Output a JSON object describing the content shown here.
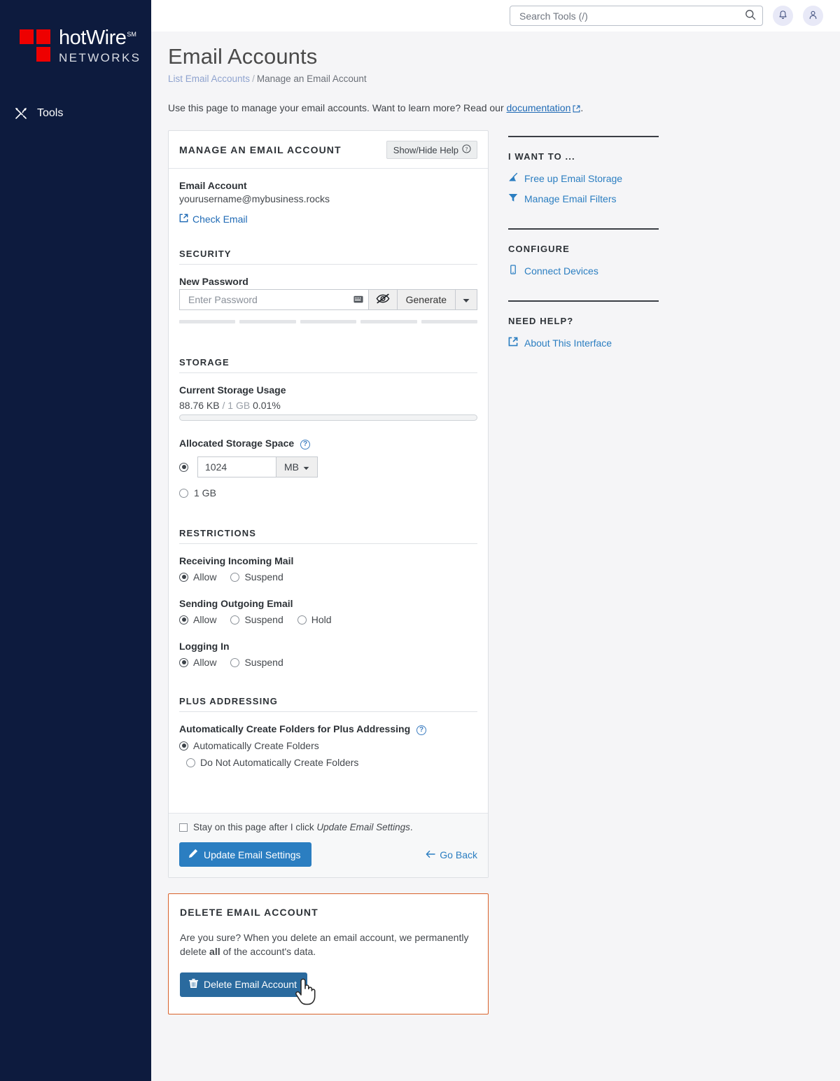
{
  "brand": {
    "name": "hotWire",
    "sm": "SM",
    "sub": "NETWORKS",
    "square_color": "#ee0000",
    "sidebar_bg": "#0d1b3e"
  },
  "sidebar": {
    "items": [
      {
        "label": "Tools",
        "icon": "tools-icon"
      }
    ]
  },
  "topbar": {
    "search": {
      "placeholder": "Search Tools (/)",
      "value": ""
    },
    "search_icon": "search-icon",
    "notifications_icon": "bell-icon",
    "account_icon": "user-icon"
  },
  "page": {
    "title": "Email Accounts",
    "breadcrumb": {
      "link": "List Email Accounts",
      "separator": "/",
      "current": "Manage an Email Account"
    },
    "intro_before": "Use this page to manage your email accounts. Want to learn more? Read our ",
    "intro_link": "documentation",
    "intro_after": "."
  },
  "card": {
    "title": "MANAGE AN EMAIL ACCOUNT",
    "help_button": "Show/Hide Help",
    "help_icon": "question-circle-icon",
    "account": {
      "label": "Email Account",
      "value": "yourusername@mybusiness.rocks",
      "check_email_link": "Check Email",
      "check_email_icon": "external-link-icon"
    },
    "security": {
      "heading": "SECURITY",
      "password_label": "New Password",
      "password_placeholder": "Enter Password",
      "password_value": "",
      "keyboard_icon": "keyboard-icon",
      "toggle_visibility_icon": "eye-slash-icon",
      "generate_label": "Generate",
      "caret_icon": "caret-down-icon",
      "strength_segments": 5
    },
    "storage": {
      "heading": "STORAGE",
      "usage_label": "Current Storage Usage",
      "usage_used": "88.76 KB",
      "usage_divider": "/",
      "usage_total": "1 GB",
      "usage_percent": "0.01%",
      "progress_value": 0.01,
      "allocated_label": "Allocated Storage Space",
      "allocated_help_icon": "question-circle-icon",
      "allocated_value": "1024",
      "allocated_unit": "MB",
      "allocated_unit_caret": "caret-down-icon",
      "allocated_selected": "custom",
      "unlimited_label": "1 GB"
    },
    "restrictions": {
      "heading": "RESTRICTIONS",
      "groups": [
        {
          "label": "Receiving Incoming Mail",
          "options": [
            "Allow",
            "Suspend"
          ],
          "selected": 0
        },
        {
          "label": "Sending Outgoing Email",
          "options": [
            "Allow",
            "Suspend",
            "Hold"
          ],
          "selected": 0
        },
        {
          "label": "Logging In",
          "options": [
            "Allow",
            "Suspend"
          ],
          "selected": 0
        }
      ]
    },
    "plus_addressing": {
      "heading": "PLUS ADDRESSING",
      "label": "Automatically Create Folders for Plus Addressing",
      "help_icon": "question-circle-icon",
      "options": [
        "Automatically Create Folders",
        "Do Not Automatically Create Folders"
      ],
      "selected": 0
    },
    "footer": {
      "stay_checkbox_checked": false,
      "stay_text_before": "Stay on this page after I click ",
      "stay_text_italic": "Update Email Settings",
      "stay_text_after": ".",
      "update_button": "Update Email Settings",
      "update_button_icon": "pencil-icon",
      "update_button_color": "#2b7ec1",
      "go_back_label": "Go Back",
      "go_back_icon": "arrow-left-icon"
    }
  },
  "delete_card": {
    "title": "DELETE EMAIL ACCOUNT",
    "text_before": "Are you sure? When you delete an email account, we permanently delete ",
    "text_bold": "all",
    "text_after": " of the account's data.",
    "button": "Delete Email Account",
    "button_icon": "trash-icon",
    "button_color": "#2a6a9e",
    "border_color": "#d9622b",
    "cursor_icon": "pointing-hand-cursor"
  },
  "right_column": {
    "blocks": [
      {
        "heading": "I WANT TO ...",
        "links": [
          {
            "label": "Free up Email Storage",
            "icon": "broom-icon"
          },
          {
            "label": "Manage Email Filters",
            "icon": "filter-icon"
          }
        ]
      },
      {
        "heading": "CONFIGURE",
        "links": [
          {
            "label": "Connect Devices",
            "icon": "mobile-icon"
          }
        ]
      },
      {
        "heading": "NEED HELP?",
        "links": [
          {
            "label": "About This Interface",
            "icon": "external-link-icon"
          }
        ]
      }
    ]
  }
}
